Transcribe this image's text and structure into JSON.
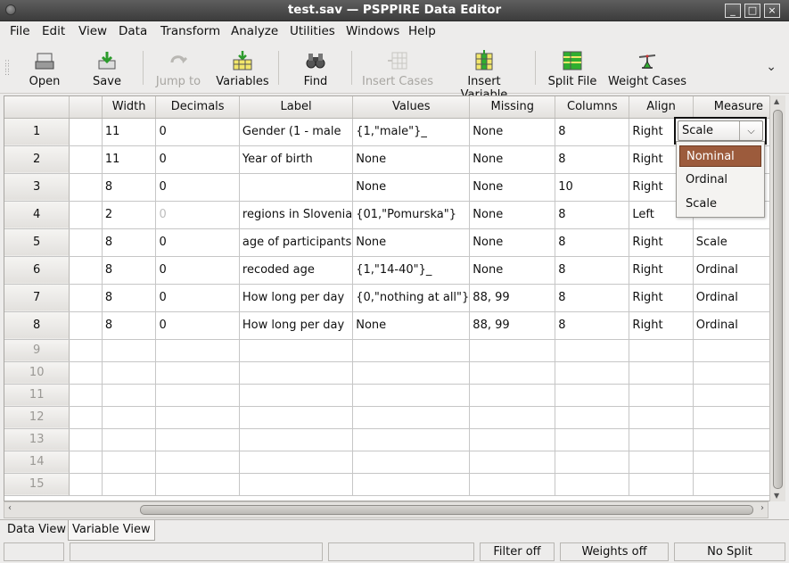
{
  "window": {
    "title": "test.sav — PSPPIRE Data Editor",
    "minimize": "_",
    "maximize": "□",
    "close": "×"
  },
  "menu": [
    "File",
    "Edit",
    "View",
    "Data",
    "Transform",
    "Analyze",
    "Utilities",
    "Windows",
    "Help"
  ],
  "toolbar": {
    "open": "Open",
    "save": "Save",
    "jump_to": "Jump to",
    "variables": "Variables",
    "find": "Find",
    "insert_cases": "Insert Cases",
    "insert_variable": "Insert Variable",
    "split_file": "Split File",
    "weight_cases": "Weight Cases"
  },
  "grid": {
    "columns": [
      "",
      "Width",
      "Decimals",
      "Label",
      "Values",
      "Missing",
      "Columns",
      "Align",
      "Measure"
    ],
    "rows": [
      {
        "n": "1",
        "name": "",
        "width": "11",
        "decimals": "0",
        "label": "Gender (1 - male",
        "values": "{1,\"male\"}_",
        "missing": "None",
        "columns": "8",
        "align": "Right",
        "measure": ""
      },
      {
        "n": "2",
        "name": "",
        "width": "11",
        "decimals": "0",
        "label": "Year of birth",
        "values": "None",
        "missing": "None",
        "columns": "8",
        "align": "Right",
        "measure": ""
      },
      {
        "n": "3",
        "name": "",
        "width": "8",
        "decimals": "0",
        "label": "",
        "values": "None",
        "missing": "None",
        "columns": "10",
        "align": "Right",
        "measure": ""
      },
      {
        "n": "4",
        "name": "",
        "width": "2",
        "decimals": "0",
        "label": "regions in Slovenia",
        "values": "{01,\"Pomurska\"}",
        "missing": "None",
        "columns": "8",
        "align": "Left",
        "measure": "Nominal"
      },
      {
        "n": "5",
        "name": "",
        "width": "8",
        "decimals": "0",
        "label": "age of participants",
        "values": "None",
        "missing": "None",
        "columns": "8",
        "align": "Right",
        "measure": "Scale"
      },
      {
        "n": "6",
        "name": "",
        "width": "8",
        "decimals": "0",
        "label": "recoded age",
        "values": "{1,\"14-40\"}_",
        "missing": "None",
        "columns": "8",
        "align": "Right",
        "measure": "Ordinal"
      },
      {
        "n": "7",
        "name": "",
        "width": "8",
        "decimals": "0",
        "label": "How long per day",
        "values": "{0,\"nothing at all\"}",
        "missing": "88, 99",
        "columns": "8",
        "align": "Right",
        "measure": "Ordinal"
      },
      {
        "n": "8",
        "name": "",
        "width": "8",
        "decimals": "0",
        "label": "How long per day",
        "values": "None",
        "missing": "88, 99",
        "columns": "8",
        "align": "Right",
        "measure": "Ordinal"
      }
    ],
    "empty_rows": [
      "9",
      "10",
      "11",
      "12",
      "13",
      "14",
      "15"
    ]
  },
  "editor": {
    "value": "Scale",
    "options": [
      "Nominal",
      "Ordinal",
      "Scale"
    ],
    "highlighted": "Nominal"
  },
  "tabs": [
    "Data View",
    "Variable View"
  ],
  "status": {
    "filter": "Filter off",
    "weights": "Weights off",
    "split": "No Split"
  },
  "colors": {
    "highlight": "#9c5b3c",
    "titlebar": "#4a4a4a"
  }
}
